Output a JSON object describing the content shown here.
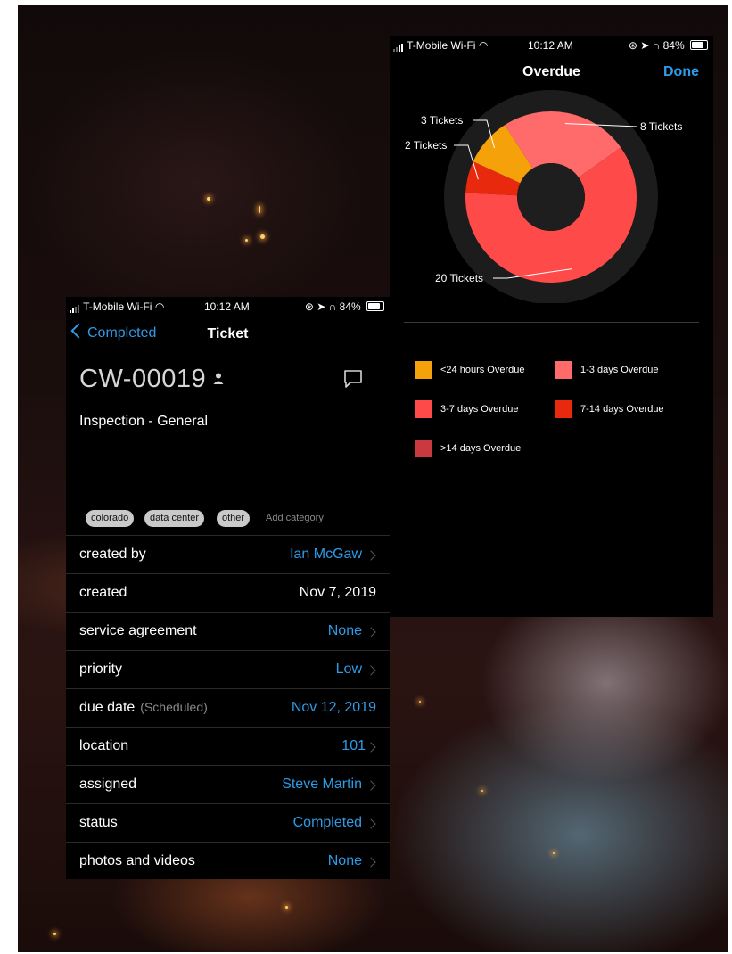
{
  "status_bar": {
    "carrier": "T-Mobile Wi-Fi",
    "time": "10:12 AM",
    "battery": "84%"
  },
  "overdue_screen": {
    "title": "Overdue",
    "done_label": "Done",
    "chart_data": {
      "type": "pie",
      "categories": [
        "<24 hours Overdue",
        "1-3 days Overdue",
        "3-7 days Overdue",
        "7-14 days Overdue",
        ">14 days Overdue"
      ],
      "values": [
        3,
        8,
        20,
        2,
        0
      ],
      "colors": [
        "#f5a20a",
        "#ff6b6b",
        "#ff4a4a",
        "#e8290e",
        "#c9393f"
      ],
      "slice_labels": [
        {
          "label": "3 Tickets",
          "value": 3,
          "color": "#f5a20a"
        },
        {
          "label": "8 Tickets",
          "value": 8,
          "color": "#ff6b6b"
        },
        {
          "label": "20 Tickets",
          "value": 20,
          "color": "#ff4a4a"
        },
        {
          "label": "2 Tickets",
          "value": 2,
          "color": "#e8290e"
        }
      ]
    },
    "legend": [
      {
        "label": "<24 hours Overdue",
        "color": "#f5a20a"
      },
      {
        "label": "1-3 days Overdue",
        "color": "#ff6b6b"
      },
      {
        "label": "3-7 days Overdue",
        "color": "#ff4a4a"
      },
      {
        "label": "7-14 days Overdue",
        "color": "#e8290e"
      },
      {
        "label": ">14 days Overdue",
        "color": "#c9393f"
      }
    ]
  },
  "ticket_screen": {
    "back_label": "Completed",
    "title": "Ticket",
    "ticket_id": "CW-00019",
    "description": "Inspection - General",
    "categories": [
      "colorado",
      "data center",
      "other"
    ],
    "add_category_label": "Add category",
    "rows": [
      {
        "label": "created by",
        "value": "Ian McGaw"
      },
      {
        "label": "created",
        "value": "Nov 7, 2019"
      },
      {
        "label": "service agreement",
        "value": "None"
      },
      {
        "label": "priority",
        "value": "Low"
      },
      {
        "label": "due date",
        "sublabel": "(Scheduled)",
        "value": "Nov 12, 2019"
      },
      {
        "label": "location",
        "value": "101"
      },
      {
        "label": "assigned",
        "value": "Steve Martin"
      },
      {
        "label": "status",
        "value": "Completed"
      },
      {
        "label": "photos and videos",
        "value": "None"
      }
    ]
  }
}
